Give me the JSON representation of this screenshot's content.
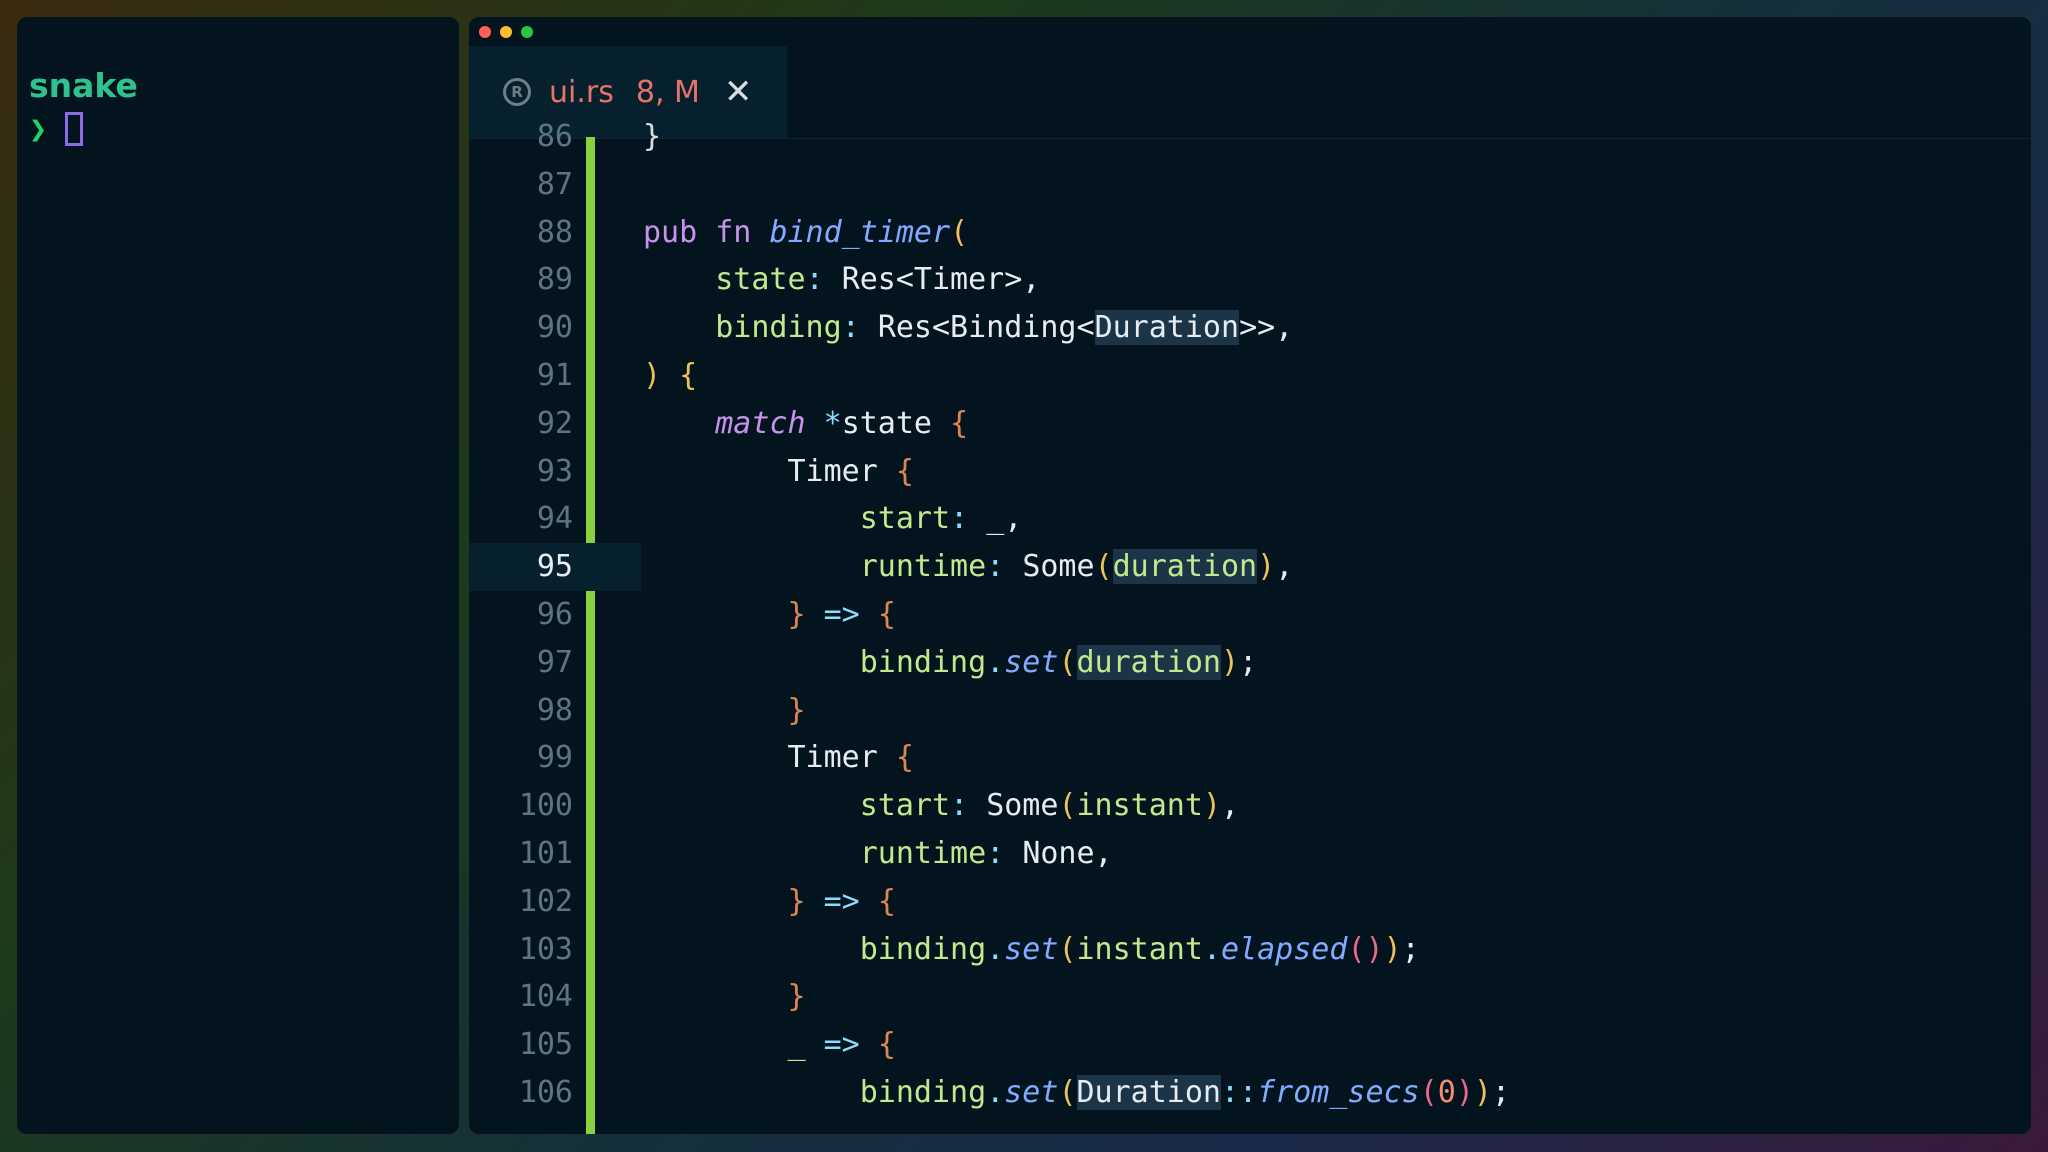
{
  "terminal": {
    "title": "snake",
    "prompt": "❯"
  },
  "window": {
    "controls": [
      "#ff5f57",
      "#febc2e",
      "#28c840"
    ]
  },
  "tab": {
    "icon": "rust-icon",
    "icon_glyph": "R",
    "filename": "ui.rs",
    "badge": "8, M",
    "close": "✕"
  },
  "editor": {
    "current_line": "95",
    "lines": [
      {
        "n": "86",
        "tokens": [
          [
            "pun",
            "}"
          ]
        ]
      },
      {
        "n": "87",
        "tokens": []
      },
      {
        "n": "88",
        "tokens": [
          [
            "kw",
            "pub fn "
          ],
          [
            "fn",
            "bind_timer"
          ],
          [
            "br1",
            "("
          ]
        ]
      },
      {
        "n": "89",
        "tokens": [
          [
            "",
            "    "
          ],
          [
            "var",
            "state"
          ],
          [
            "op",
            ": "
          ],
          [
            "",
            "Res<Timer>,"
          ]
        ]
      },
      {
        "n": "90",
        "tokens": [
          [
            "",
            "    "
          ],
          [
            "var",
            "binding"
          ],
          [
            "op",
            ": "
          ],
          [
            "",
            "Res<Binding<"
          ],
          [
            "sel",
            "Duration"
          ],
          [
            "",
            ">>,"
          ]
        ]
      },
      {
        "n": "91",
        "tokens": [
          [
            "br1",
            ")"
          ],
          [
            "",
            " "
          ],
          [
            "br1",
            "{"
          ]
        ]
      },
      {
        "n": "92",
        "tokens": [
          [
            "",
            "    "
          ],
          [
            "kwi",
            "match"
          ],
          [
            "",
            " "
          ],
          [
            "op",
            "*"
          ],
          [
            "",
            "state "
          ],
          [
            "br2",
            "{"
          ]
        ]
      },
      {
        "n": "93",
        "tokens": [
          [
            "",
            "        Timer "
          ],
          [
            "br2",
            "{"
          ]
        ]
      },
      {
        "n": "94",
        "tokens": [
          [
            "",
            "            "
          ],
          [
            "var",
            "start"
          ],
          [
            "op",
            ": "
          ],
          [
            "",
            "_,"
          ]
        ]
      },
      {
        "n": "95",
        "tokens": [
          [
            "",
            "            "
          ],
          [
            "var",
            "runtime"
          ],
          [
            "op",
            ": "
          ],
          [
            "",
            "Some"
          ],
          [
            "br1",
            "("
          ],
          [
            "sel var",
            "duration"
          ],
          [
            "br1",
            ")"
          ],
          [
            "",
            ","
          ]
        ]
      },
      {
        "n": "96",
        "tokens": [
          [
            "",
            "        "
          ],
          [
            "br2",
            "}"
          ],
          [
            "op",
            " => "
          ],
          [
            "br2",
            "{"
          ]
        ]
      },
      {
        "n": "97",
        "tokens": [
          [
            "",
            "            "
          ],
          [
            "var",
            "binding"
          ],
          [
            "op",
            "."
          ],
          [
            "fn",
            "set"
          ],
          [
            "br1",
            "("
          ],
          [
            "sel var",
            "duration"
          ],
          [
            "br1",
            ")"
          ],
          [
            "",
            ";"
          ]
        ]
      },
      {
        "n": "98",
        "tokens": [
          [
            "",
            "        "
          ],
          [
            "br2",
            "}"
          ]
        ]
      },
      {
        "n": "99",
        "tokens": [
          [
            "",
            "        Timer "
          ],
          [
            "br2",
            "{"
          ]
        ]
      },
      {
        "n": "100",
        "tokens": [
          [
            "",
            "            "
          ],
          [
            "var",
            "start"
          ],
          [
            "op",
            ": "
          ],
          [
            "",
            "Some"
          ],
          [
            "br1",
            "("
          ],
          [
            "var",
            "instant"
          ],
          [
            "br1",
            ")"
          ],
          [
            "",
            ","
          ]
        ]
      },
      {
        "n": "101",
        "tokens": [
          [
            "",
            "            "
          ],
          [
            "var",
            "runtime"
          ],
          [
            "op",
            ": "
          ],
          [
            "",
            "None,"
          ]
        ]
      },
      {
        "n": "102",
        "tokens": [
          [
            "",
            "        "
          ],
          [
            "br2",
            "}"
          ],
          [
            "op",
            " => "
          ],
          [
            "br2",
            "{"
          ]
        ]
      },
      {
        "n": "103",
        "tokens": [
          [
            "",
            "            "
          ],
          [
            "var",
            "binding"
          ],
          [
            "op",
            "."
          ],
          [
            "fn",
            "set"
          ],
          [
            "br1",
            "("
          ],
          [
            "var",
            "instant"
          ],
          [
            "op",
            "."
          ],
          [
            "fn",
            "elapsed"
          ],
          [
            "br3",
            "()"
          ],
          [
            "br1",
            ")"
          ],
          [
            "",
            ";"
          ]
        ]
      },
      {
        "n": "104",
        "tokens": [
          [
            "",
            "        "
          ],
          [
            "br2",
            "}"
          ]
        ]
      },
      {
        "n": "105",
        "tokens": [
          [
            "",
            "        "
          ],
          [
            "var",
            "_"
          ],
          [
            "op",
            " => "
          ],
          [
            "br2",
            "{"
          ]
        ]
      },
      {
        "n": "106",
        "tokens": [
          [
            "",
            "            "
          ],
          [
            "var",
            "binding"
          ],
          [
            "op",
            "."
          ],
          [
            "fn",
            "set"
          ],
          [
            "br1",
            "("
          ],
          [
            "sel",
            "Duration"
          ],
          [
            "op",
            "::"
          ],
          [
            "fn",
            "from_secs"
          ],
          [
            "br3",
            "("
          ],
          [
            "num",
            "0"
          ],
          [
            "br3",
            ")"
          ],
          [
            "br1",
            ")"
          ],
          [
            "",
            ";"
          ]
        ]
      }
    ]
  }
}
